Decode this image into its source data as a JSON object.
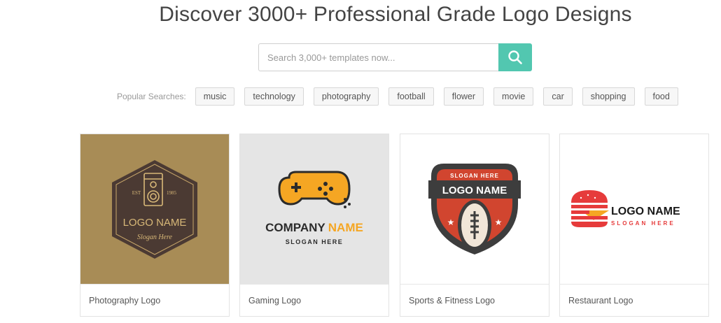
{
  "header": {
    "title": "Discover 3000+ Professional Grade Logo Designs"
  },
  "search": {
    "placeholder": "Search 3,000+ templates now...",
    "value": "",
    "icon": "search-icon",
    "button_color": "#52c7b0"
  },
  "popular": {
    "label": "Popular Searches:",
    "tags": [
      "music",
      "technology",
      "photography",
      "football",
      "flower",
      "movie",
      "car",
      "shopping",
      "food"
    ]
  },
  "cards": [
    {
      "caption": "Photography Logo",
      "logo": {
        "est": "EST",
        "year": "1985",
        "name": "LOGO NAME",
        "slogan": "Slogan Here",
        "bg": "#a88c56",
        "badge": "#4b3a33"
      }
    },
    {
      "caption": "Gaming Logo",
      "logo": {
        "company": "COMPANY",
        "name": "NAME",
        "slogan": "SLOGAN HERE",
        "bg": "#e5e5e5",
        "accent": "#f5a623"
      }
    },
    {
      "caption": "Sports & Fitness Logo",
      "logo": {
        "slogan": "SLOGAN HERE",
        "name": "LOGO NAME",
        "accent": "#d1452f",
        "dark": "#3d3d3d"
      }
    },
    {
      "caption": "Restaurant Logo",
      "logo": {
        "name": "LOGO NAME",
        "slogan": "SLOGAN HERE",
        "accent": "#e63b3b",
        "cheese": "#f5a623"
      }
    }
  ]
}
